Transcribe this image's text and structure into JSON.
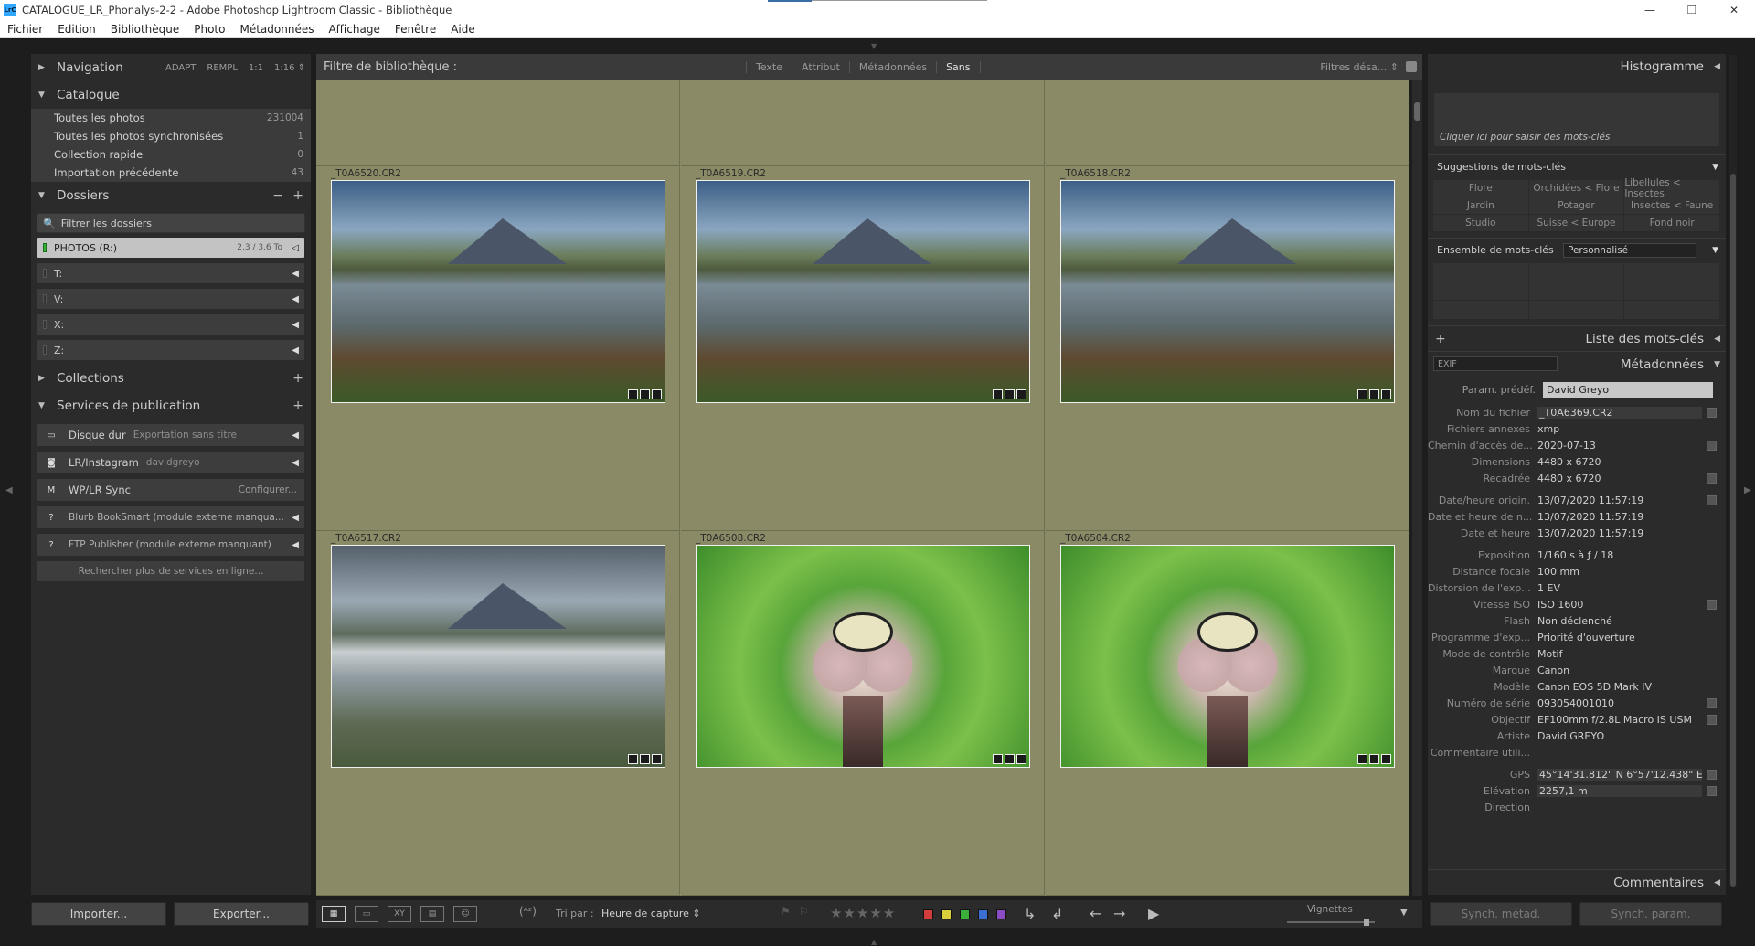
{
  "window": {
    "title": "CATALOGUE_LR_Phonalys-2-2 - Adobe Photoshop Lightroom Classic - Bibliothèque",
    "logo": "LrC",
    "controls": [
      "—",
      "❐",
      "✕"
    ]
  },
  "menu": [
    "Fichier",
    "Edition",
    "Bibliothèque",
    "Photo",
    "Métadonnées",
    "Affichage",
    "Fenêtre",
    "Aide"
  ],
  "left": {
    "navigation": {
      "title": "Navigation",
      "zoom": [
        "ADAPT",
        "REMPL",
        "1:1",
        "1:16 ⇕"
      ]
    },
    "catalogue": {
      "title": "Catalogue",
      "rows": [
        {
          "label": "Toutes les photos",
          "count": "231004"
        },
        {
          "label": "Toutes les photos synchronisées",
          "count": "1"
        },
        {
          "label": "Collection rapide",
          "count": "0"
        },
        {
          "label": "Importation précédente",
          "count": "43"
        }
      ]
    },
    "dossiers": {
      "title": "Dossiers",
      "filter_placeholder": "Filtrer les dossiers",
      "volumes": [
        {
          "label": "PHOTOS (R:)",
          "info": "2,3 / 3,6 To"
        },
        {
          "label": "T:",
          "info": ""
        },
        {
          "label": "V:",
          "info": ""
        },
        {
          "label": "X:",
          "info": ""
        },
        {
          "label": "Z:",
          "info": ""
        }
      ]
    },
    "collections": {
      "title": "Collections"
    },
    "services": {
      "title": "Services de publication",
      "rows": [
        {
          "icon": "hard-disk-icon",
          "label": "Disque dur",
          "sub": "Exportation sans titre"
        },
        {
          "icon": "instagram-icon",
          "label": "LR/Instagram",
          "sub": "davidgreyo"
        },
        {
          "icon": "wordpress-icon",
          "label": "WP/LR Sync",
          "sub": "",
          "config": "Configurer..."
        },
        {
          "icon": "missing-plugin-icon",
          "label": "Blurb BookSmart (module externe manqua...",
          "sub": ""
        },
        {
          "icon": "missing-plugin-icon",
          "label": "FTP Publisher (module externe manquant)",
          "sub": ""
        }
      ],
      "more": "Rechercher plus de services en ligne..."
    },
    "import_btn": "Importer...",
    "export_btn": "Exporter..."
  },
  "filterbar": {
    "label": "Filtre de bibliothèque :",
    "tabs": [
      "Texte",
      "Attribut",
      "Métadonnées",
      "Sans"
    ],
    "active_tab": "Sans",
    "presets": "Filtres désa... ⇕"
  },
  "grid": {
    "rows": [
      [
        {
          "name": "",
          "kind": "rock"
        },
        {
          "name": "",
          "kind": "rock"
        },
        {
          "name": "",
          "kind": "rock"
        }
      ],
      [
        {
          "name": "_T0A6520.CR2",
          "kind": "lake"
        },
        {
          "name": "_T0A6519.CR2",
          "kind": "lake"
        },
        {
          "name": "_T0A6518.CR2",
          "kind": "lake"
        }
      ],
      [
        {
          "name": "_T0A6517.CR2",
          "kind": "lake2"
        },
        {
          "name": "_T0A6508.CR2",
          "kind": "fly"
        },
        {
          "name": "_T0A6504.CR2",
          "kind": "fly"
        }
      ]
    ]
  },
  "toolbar": {
    "sort_label": "Tri par :",
    "sort_value": "Heure de capture ⇕",
    "stars": "★★★★★",
    "colors": [
      "#d23c3c",
      "#d8cf3a",
      "#3cae3c",
      "#3c6fd2",
      "#8a4cc0"
    ],
    "vignettes": "Vignettes"
  },
  "right": {
    "histogram": "Histogramme",
    "keyword_hint": "Cliquer ici pour saisir des mots-clés",
    "suggestions": {
      "title": "Suggestions de mots-clés",
      "items": [
        "Flore",
        "Orchidées < Flore",
        "Libellules < Insectes",
        "Jardin",
        "Potager",
        "Insectes < Faune",
        "Studio",
        "Suisse < Europe",
        "Fond noir"
      ]
    },
    "keyword_set": {
      "title": "Ensemble de mots-clés",
      "value": "Personnalisé"
    },
    "keyword_list": "Liste des mots-clés",
    "metadata": {
      "title": "Métadonnées",
      "preset_select": "EXIF",
      "preset_label": "Param. prédéf.",
      "preset_value": "David Greyo",
      "groups": [
        [
          {
            "k": "Nom du fichier",
            "v": "_T0A6369.CR2",
            "btn": true,
            "boxed": true
          },
          {
            "k": "Fichiers annexes",
            "v": "xmp"
          },
          {
            "k": "Chemin d'accès de...",
            "v": "2020-07-13",
            "btn": true
          },
          {
            "k": "Dimensions",
            "v": "4480 x 6720"
          },
          {
            "k": "Recadrée",
            "v": "4480 x 6720",
            "btn": true
          }
        ],
        [
          {
            "k": "Date/heure origin.",
            "v": "13/07/2020 11:57:19",
            "btn": true
          },
          {
            "k": "Date et heure de n...",
            "v": "13/07/2020 11:57:19"
          },
          {
            "k": "Date et heure",
            "v": "13/07/2020 11:57:19"
          }
        ],
        [
          {
            "k": "Exposition",
            "v": "1/160 s à ƒ / 18"
          },
          {
            "k": "Distance focale",
            "v": "100 mm"
          },
          {
            "k": "Distorsion de l'exp...",
            "v": "1 EV"
          },
          {
            "k": "Vitesse ISO",
            "v": "ISO 1600",
            "btn": true
          },
          {
            "k": "Flash",
            "v": "Non déclenché"
          },
          {
            "k": "Programme d'exp...",
            "v": "Priorité d'ouverture"
          },
          {
            "k": "Mode de contrôle",
            "v": "Motif"
          },
          {
            "k": "Marque",
            "v": "Canon"
          },
          {
            "k": "Modèle",
            "v": "Canon EOS 5D Mark IV"
          },
          {
            "k": "Numéro de série",
            "v": "093054001010",
            "btn": true
          },
          {
            "k": "Objectif",
            "v": "EF100mm f/2.8L Macro IS USM",
            "btn": true
          },
          {
            "k": "Artiste",
            "v": "David GREYO"
          },
          {
            "k": "Commentaire utili...",
            "v": ""
          }
        ],
        [
          {
            "k": "GPS",
            "v": "45°14'31.812\" N 6°57'12.438\" E",
            "btn": true,
            "boxed": true
          },
          {
            "k": "Elévation",
            "v": "2257,1 m",
            "btn": true,
            "boxed": true
          },
          {
            "k": "Direction",
            "v": "",
            "boxed": true
          }
        ]
      ]
    },
    "comments": "Commentaires",
    "sync_meta": "Synch. métad.",
    "sync_param": "Synch. param."
  }
}
